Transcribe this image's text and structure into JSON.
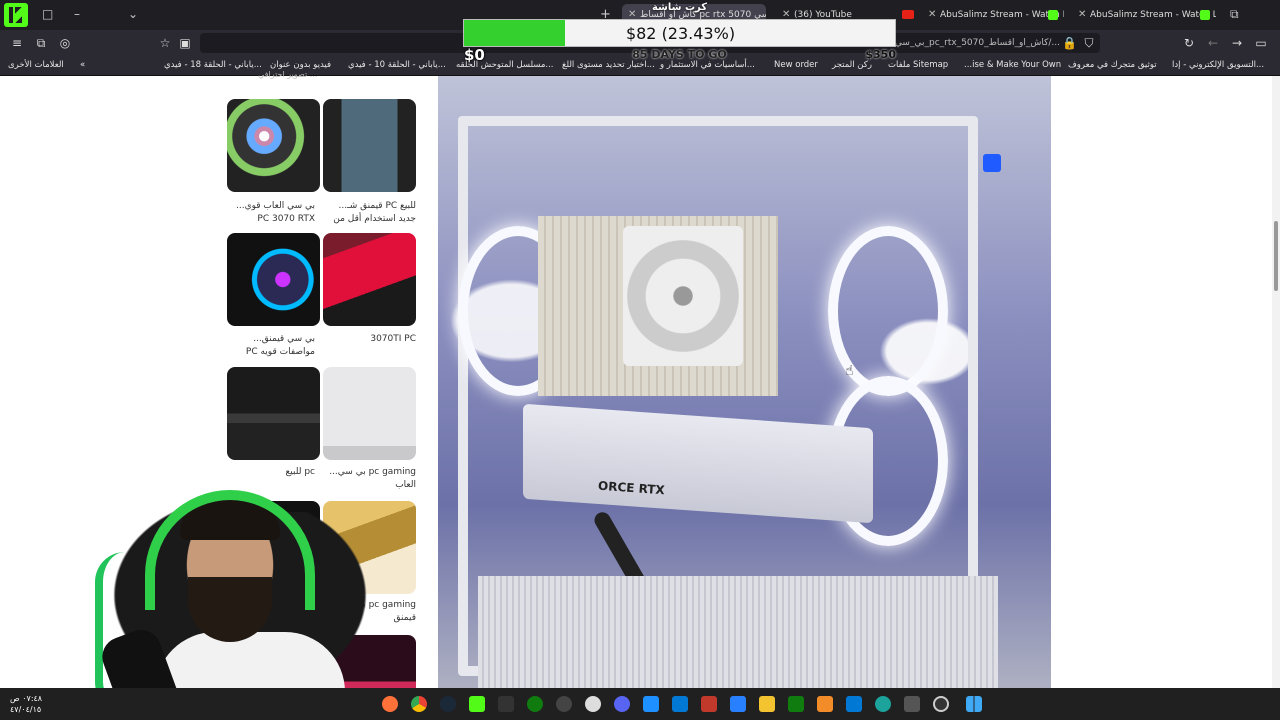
{
  "window": {
    "tabs": [
      {
        "label": "كاش او اقساط pc rtx 5070 بي سي",
        "active": true
      },
      {
        "label": "(36) YouTube",
        "active": false
      },
      {
        "label": "AbuSalimz Stream - Watch Live",
        "active": false
      },
      {
        "label": "AbuSalimz Stream - Watch Live",
        "active": false
      }
    ]
  },
  "toolbar": {
    "url": "...900/بي_سي_pc_rtx_5070_كاش_او_اقساط/..."
  },
  "bookmarks": {
    "items": [
      {
        "label": "التسويق الإلكتروني - إدا..."
      },
      {
        "label": "توثيق متجرك في معروف"
      },
      {
        "label": "...ise & Make Your Own"
      },
      {
        "label": "ملفات Sitemap"
      },
      {
        "label": "ركن المتجر"
      },
      {
        "label": "New order"
      },
      {
        "label": "أساسيات في الاستثمار و..."
      },
      {
        "label": "اختبار تحديد مستوى اللغ..."
      },
      {
        "label": "مسلسل المتوحش الحلقه..."
      },
      {
        "label": "ياباني - الحلقة 10 - فيدي..."
      },
      {
        "label": "فيديو بدون عنوان"
      },
      {
        "label": "ياباني - الحلقة 18 - فيدي..."
      },
      {
        "label": "العلامات الأخرى"
      }
    ]
  },
  "goal": {
    "title": "كرت شاشة",
    "amount_text": "$82 (23.43%)",
    "progress_fraction": 0.2343,
    "min": "$0",
    "max": "$350",
    "days": "85 DAYS TO GO",
    "fill_color": "#34d12e"
  },
  "listings": {
    "top_label": "تصوير احترافي ...",
    "items": [
      {
        "caption": "بي سي العاب قوي... PC 3070 RTX"
      },
      {
        "caption": "للبيع PC قيمنق شـ... جديد استخدام أقل من"
      },
      {
        "caption": "بي سي قيمنق... مواصفات قويه PC"
      },
      {
        "caption": "3070TI PC"
      },
      {
        "caption": "pc للبيع"
      },
      {
        "caption": "pc gaming بي سي... العاب"
      },
      {
        "caption": ""
      },
      {
        "caption": "pc gaming بيسي... قيمنق"
      },
      {
        "caption": ""
      }
    ]
  },
  "main_photo": {
    "gpu_label": "ORCE RTX"
  },
  "taskbar": {
    "time": "٠٧:٤٨ ص",
    "date": "٤٧/٠٤/١٥"
  }
}
